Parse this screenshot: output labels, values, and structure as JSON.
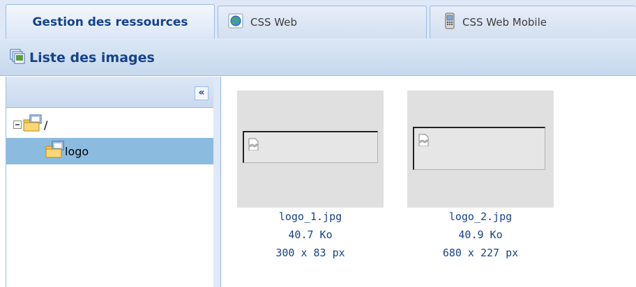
{
  "tabs": [
    {
      "label": "Gestion des ressources",
      "active": true
    },
    {
      "label": "CSS Web",
      "icon": "globe-icon"
    },
    {
      "label": "CSS Web Mobile",
      "icon": "mobile-phone-icon"
    }
  ],
  "panel": {
    "title": "Liste des images",
    "icon": "image-list-icon"
  },
  "tree": {
    "collapse_label": "«",
    "nodes": [
      {
        "label": "/",
        "expanded": true,
        "icon": "folder-icon"
      },
      {
        "label": "logo",
        "selected": true,
        "icon": "folder-icon"
      }
    ]
  },
  "images": [
    {
      "filename": "logo_1.jpg",
      "size": "40.7 Ko",
      "dimensions": "300 x 83 px"
    },
    {
      "filename": "logo_2.jpg",
      "size": "40.9 Ko",
      "dimensions": "680 x 227 px"
    }
  ],
  "colors": {
    "accent": "#15428b",
    "border": "#99bbe8",
    "selected": "#8cbbe0"
  }
}
